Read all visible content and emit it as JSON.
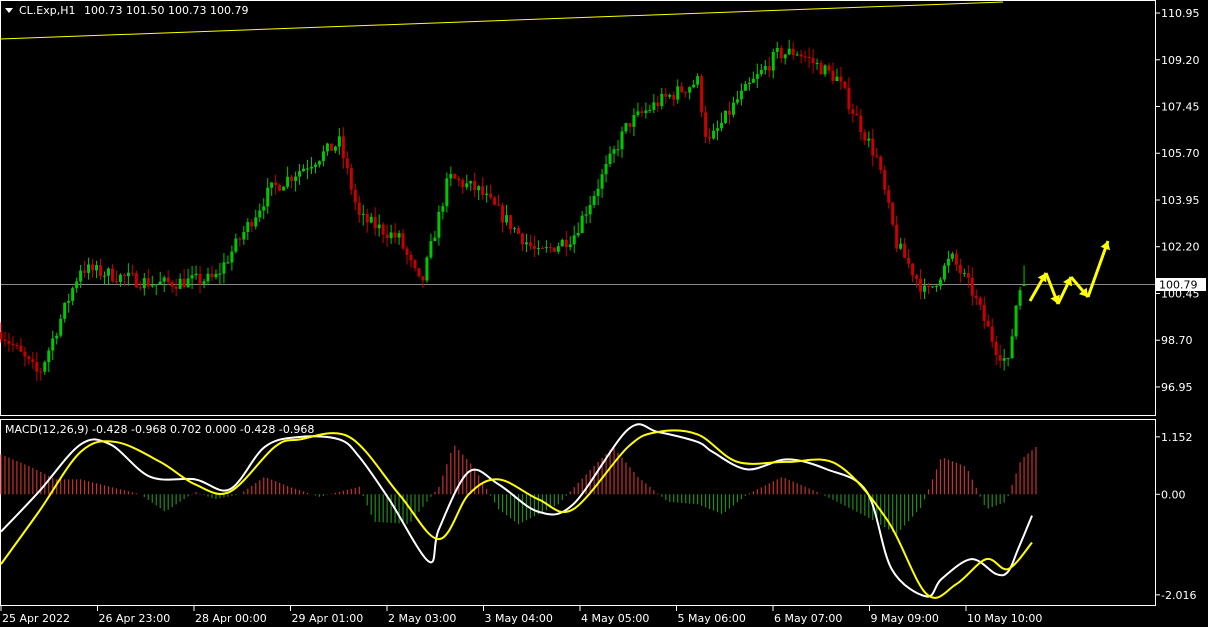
{
  "header": {
    "symbol_label": "CL.Exp,H1",
    "ohlc_label": "100.73 101.50 100.73 100.79"
  },
  "macd_label": "MACD(12,26,9) -0.428 -0.968 0.702 0.000 -0.428 -0.968",
  "current_price_label": "100.79",
  "colors": {
    "bull": "#00c800",
    "bear": "#c80000",
    "trendline": "#ffff00",
    "macd_line": "#ffffff",
    "signal_line": "#ffff00",
    "hist_pos": "#c83232",
    "hist_neg": "#1e8c1e",
    "arrows": "#ffff00",
    "axis": "#ffffff",
    "current_price_line": "#888888"
  },
  "chart_data": [
    {
      "type": "candlestick",
      "title": "CL.Exp,H1",
      "y_ticks": [
        "110.95",
        "109.20",
        "107.45",
        "105.70",
        "103.95",
        "102.20",
        "100.45",
        "98.70",
        "96.95"
      ],
      "ylim": [
        95.9,
        111.4
      ],
      "x_ticks": [
        "25 Apr 2022",
        "26 Apr 23:00",
        "28 Apr 00:00",
        "29 Apr 01:00",
        "2 May 03:00",
        "3 May 04:00",
        "4 May 05:00",
        "5 May 06:00",
        "6 May 07:00",
        "9 May 09:00",
        "10 May 10:00"
      ],
      "last_price": 100.79,
      "last_bar": {
        "open": 100.73,
        "high": 101.5,
        "low": 100.73,
        "close": 100.79
      },
      "key_closes": [
        {
          "t": 0,
          "v": 99.0
        },
        {
          "t": 38,
          "v": 97.4
        },
        {
          "t": 80,
          "v": 101.4
        },
        {
          "t": 155,
          "v": 100.8
        },
        {
          "t": 215,
          "v": 101.0
        },
        {
          "t": 270,
          "v": 104.3
        },
        {
          "t": 340,
          "v": 106.1
        },
        {
          "t": 360,
          "v": 103.3
        },
        {
          "t": 400,
          "v": 102.5
        },
        {
          "t": 422,
          "v": 100.7
        },
        {
          "t": 450,
          "v": 104.8
        },
        {
          "t": 480,
          "v": 104.3
        },
        {
          "t": 540,
          "v": 101.9
        },
        {
          "t": 575,
          "v": 102.6
        },
        {
          "t": 630,
          "v": 106.8
        },
        {
          "t": 660,
          "v": 107.6
        },
        {
          "t": 700,
          "v": 108.4
        },
        {
          "t": 710,
          "v": 106.0
        },
        {
          "t": 740,
          "v": 107.7
        },
        {
          "t": 780,
          "v": 109.4
        },
        {
          "t": 800,
          "v": 109.5
        },
        {
          "t": 840,
          "v": 108.5
        },
        {
          "t": 880,
          "v": 105.5
        },
        {
          "t": 900,
          "v": 102.3
        },
        {
          "t": 930,
          "v": 100.4
        },
        {
          "t": 955,
          "v": 101.8
        },
        {
          "t": 975,
          "v": 100.6
        },
        {
          "t": 1000,
          "v": 98.4
        },
        {
          "t": 1012,
          "v": 97.8
        },
        {
          "t": 1022,
          "v": 100.6
        },
        {
          "t": 1031,
          "v": 100.79
        }
      ]
    },
    {
      "type": "line",
      "title": "MACD(12,26,9)",
      "y_ticks": [
        "1.152",
        "0.00",
        "-2.016"
      ],
      "ylim": [
        -2.24,
        1.49
      ],
      "values_label": "-0.428 -0.968 0.702 0.000 -0.428 -0.968",
      "series": [
        {
          "name": "MACD",
          "points": [
            [
              0,
              -0.75
            ],
            [
              38,
              0.05
            ],
            [
              80,
              1.0
            ],
            [
              110,
              1.0
            ],
            [
              150,
              0.35
            ],
            [
              195,
              0.3
            ],
            [
              230,
              0.1
            ],
            [
              265,
              0.95
            ],
            [
              300,
              1.15
            ],
            [
              340,
              1.1
            ],
            [
              360,
              0.75
            ],
            [
              390,
              -0.1
            ],
            [
              430,
              -1.35
            ],
            [
              440,
              -0.7
            ],
            [
              470,
              0.45
            ],
            [
              500,
              0.2
            ],
            [
              540,
              -0.35
            ],
            [
              575,
              -0.2
            ],
            [
              630,
              1.3
            ],
            [
              660,
              1.25
            ],
            [
              700,
              1.05
            ],
            [
              715,
              0.85
            ],
            [
              750,
              0.5
            ],
            [
              790,
              0.7
            ],
            [
              830,
              0.5
            ],
            [
              870,
              0.05
            ],
            [
              895,
              -1.5
            ],
            [
              930,
              -2.05
            ],
            [
              945,
              -1.7
            ],
            [
              975,
              -1.3
            ],
            [
              1000,
              -1.6
            ],
            [
              1012,
              -1.55
            ],
            [
              1022,
              -1.1
            ],
            [
              1036,
              -0.428
            ]
          ]
        },
        {
          "name": "Signal",
          "points": [
            [
              0,
              -1.4
            ],
            [
              38,
              -0.35
            ],
            [
              80,
              0.85
            ],
            [
              115,
              1.05
            ],
            [
              160,
              0.65
            ],
            [
              195,
              0.2
            ],
            [
              230,
              0.05
            ],
            [
              275,
              0.95
            ],
            [
              300,
              1.1
            ],
            [
              350,
              1.15
            ],
            [
              400,
              0.0
            ],
            [
              440,
              -0.9
            ],
            [
              470,
              0.0
            ],
            [
              500,
              0.3
            ],
            [
              540,
              -0.1
            ],
            [
              575,
              -0.3
            ],
            [
              630,
              0.95
            ],
            [
              660,
              1.25
            ],
            [
              700,
              1.2
            ],
            [
              740,
              0.65
            ],
            [
              790,
              0.65
            ],
            [
              840,
              0.6
            ],
            [
              890,
              -0.5
            ],
            [
              930,
              -2.0
            ],
            [
              960,
              -1.8
            ],
            [
              990,
              -1.3
            ],
            [
              1012,
              -1.5
            ],
            [
              1036,
              -0.968
            ]
          ]
        }
      ],
      "histogram_points": [
        [
          0,
          0.8
        ],
        [
          30,
          0.55
        ],
        [
          55,
          0.3
        ],
        [
          80,
          0.3
        ],
        [
          110,
          0.15
        ],
        [
          140,
          0.0
        ],
        [
          165,
          -0.35
        ],
        [
          195,
          0.05
        ],
        [
          215,
          -0.1
        ],
        [
          240,
          0.0
        ],
        [
          265,
          0.35
        ],
        [
          290,
          0.15
        ],
        [
          320,
          -0.05
        ],
        [
          360,
          0.15
        ],
        [
          375,
          -0.55
        ],
        [
          410,
          -0.6
        ],
        [
          440,
          0.15
        ],
        [
          455,
          1.0
        ],
        [
          475,
          0.55
        ],
        [
          500,
          -0.3
        ],
        [
          520,
          -0.6
        ],
        [
          560,
          -0.2
        ],
        [
          595,
          0.55
        ],
        [
          615,
          0.95
        ],
        [
          640,
          0.35
        ],
        [
          670,
          -0.15
        ],
        [
          700,
          -0.2
        ],
        [
          725,
          -0.4
        ],
        [
          750,
          0.0
        ],
        [
          785,
          0.35
        ],
        [
          820,
          0.05
        ],
        [
          870,
          -0.45
        ],
        [
          900,
          -0.8
        ],
        [
          925,
          -0.25
        ],
        [
          945,
          0.75
        ],
        [
          970,
          0.55
        ],
        [
          990,
          -0.3
        ],
        [
          1010,
          -0.15
        ],
        [
          1025,
          0.7
        ],
        [
          1040,
          0.95
        ]
      ]
    }
  ]
}
